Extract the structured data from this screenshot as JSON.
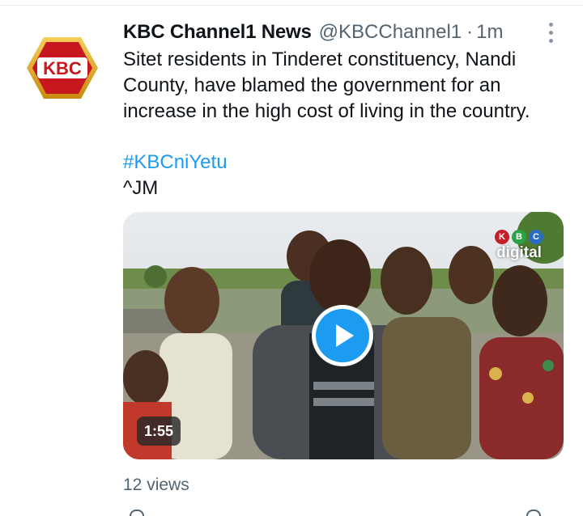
{
  "tweet": {
    "author": {
      "display_name": "KBC Channel1 News",
      "handle": "@KBCChannel1",
      "separator": "·",
      "time_ago": "1m",
      "avatar_text": "KBC"
    },
    "text_lines": [
      "Sitet residents in Tinderet constituency, Nandi",
      "County, have blamed the government for an",
      "increase in the high cost of living in the country."
    ],
    "hashtag": "#KBCniYetu",
    "signature": "^JM",
    "media": {
      "type": "video",
      "duration": "1:55",
      "watermark_letters": [
        "K",
        "B",
        "C"
      ],
      "watermark_word": "digital",
      "play_icon": "play-icon"
    },
    "views": "12 views"
  },
  "colors": {
    "accent": "#1d9bf0",
    "text": "#0f1419",
    "muted": "#536471",
    "avatar_red": "#c8181f",
    "avatar_gold": "#e0a21a"
  }
}
